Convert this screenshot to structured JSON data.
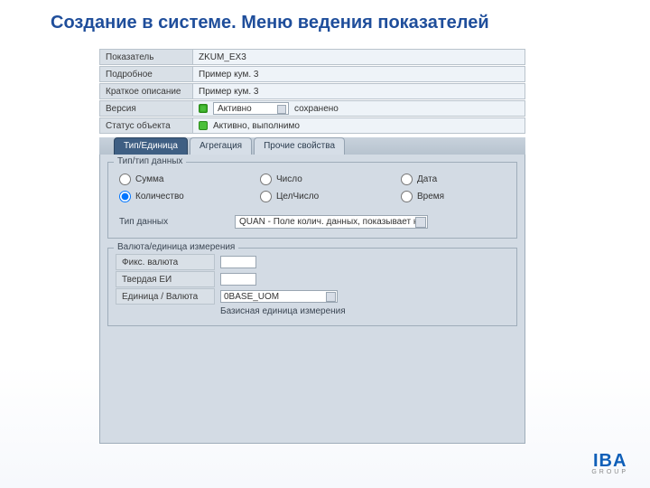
{
  "title": "Создание в системе. Меню ведения показателей",
  "header": {
    "indicator": {
      "label": "Показатель",
      "value": "ZKUM_EX3"
    },
    "long_desc": {
      "label": "Подробное описание",
      "value": "Пример кум. 3"
    },
    "short_desc": {
      "label": "Краткое описание",
      "value": "Пример кум. 3"
    },
    "version": {
      "label": "Версия",
      "select_value": "Активно",
      "status_text": "сохранено"
    },
    "obj_status": {
      "label": "Статус объекта",
      "text": "Активно, выполнимо"
    }
  },
  "tabs": {
    "type_unit": "Тип/Единица",
    "aggregation": "Агрегация",
    "other": "Прочие свойства"
  },
  "type_group": {
    "title": "Тип/тип данных",
    "options": {
      "sum": "Сумма",
      "number": "Число",
      "date": "Дата",
      "quantity": "Количество",
      "integer": "ЦелЧисло",
      "time": "Время"
    },
    "data_type_label": "Тип данных",
    "data_type_value": "QUAN - Поле колич. данных, показывает на"
  },
  "currency_group": {
    "title": "Валюта/единица измерения",
    "fixed_currency_label": "Фикс. валюта",
    "fixed_currency_value": "",
    "fixed_uom_label": "Твердая ЕИ",
    "fixed_uom_value": "",
    "unit_currency_label": "Единица / Валюта",
    "unit_currency_value": "0BASE_UOM",
    "unit_currency_desc": "Базисная единица измерения"
  },
  "logo": {
    "top": "IBA",
    "bottom": "GROUP"
  }
}
